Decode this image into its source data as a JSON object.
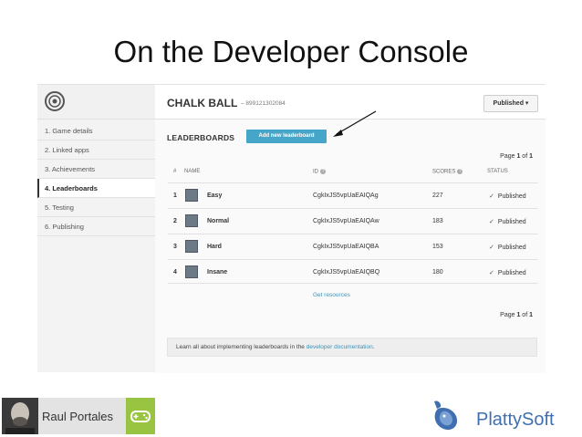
{
  "slide": {
    "title": "On the Developer Console"
  },
  "console": {
    "game_title": "CHALK BALL",
    "game_id": "– 899121302084",
    "publish_state": "Published ▾",
    "sidebar": [
      {
        "label": "1. Game details"
      },
      {
        "label": "2. Linked apps"
      },
      {
        "label": "3. Achievements"
      },
      {
        "label": "4. Leaderboards",
        "active": true
      },
      {
        "label": "5. Testing"
      },
      {
        "label": "6. Publishing"
      }
    ],
    "section_title": "LEADERBOARDS",
    "add_button": "Add new leaderboard",
    "pagination_top": {
      "prefix": "Page ",
      "current": "1",
      "sep": " of ",
      "total": "1"
    },
    "pagination_bottom": {
      "prefix": "Page ",
      "current": "1",
      "sep": " of ",
      "total": "1"
    },
    "columns": {
      "num": "#",
      "name": "NAME",
      "id": "ID",
      "scores": "SCORES",
      "status": "STATUS"
    },
    "rows": [
      {
        "num": "1",
        "name": "Easy",
        "id": "CgkIxJS5vpUaEAIQAg",
        "scores": "227",
        "status": "Published"
      },
      {
        "num": "2",
        "name": "Normal",
        "id": "CgkIxJS5vpUaEAIQAw",
        "scores": "183",
        "status": "Published"
      },
      {
        "num": "3",
        "name": "Hard",
        "id": "CgkIxJS5vpUaEAIQBA",
        "scores": "153",
        "status": "Published"
      },
      {
        "num": "4",
        "name": "Insane",
        "id": "CgkIxJS5vpUaEAIQBQ",
        "scores": "180",
        "status": "Published"
      }
    ],
    "get_resources": "Get resources",
    "footer": {
      "before": "Learn all about implementing leaderboards in the ",
      "link": "developer documentation",
      "after": "."
    }
  },
  "author": {
    "name": "Raul Portales"
  },
  "brand": {
    "name": "PlattySoft"
  },
  "colors": {
    "accent": "#45a6c9",
    "link": "#3f92b7",
    "android_green": "#98c441",
    "brand_blue": "#3f6fb0"
  }
}
